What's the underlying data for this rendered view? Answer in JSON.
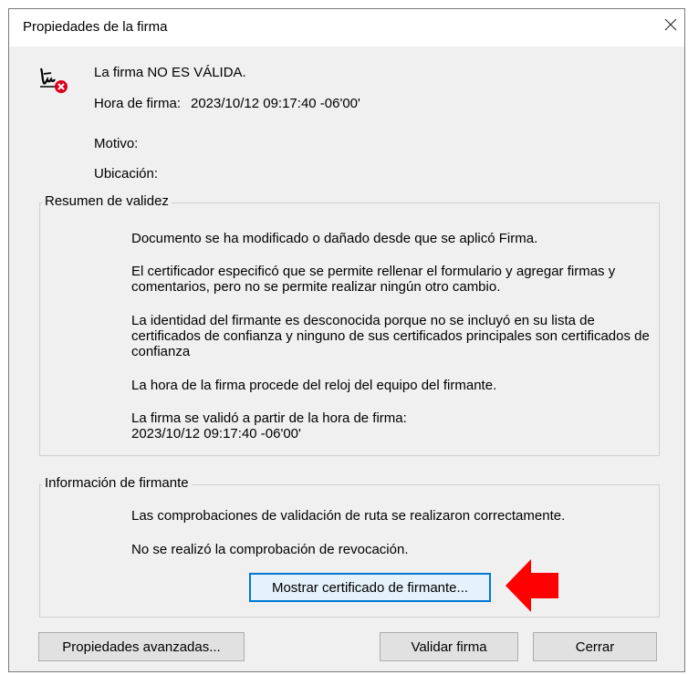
{
  "dialog": {
    "title": "Propiedades de la firma"
  },
  "signature": {
    "status": "La firma NO ES VÁLIDA.",
    "time_label": "Hora de firma:",
    "time_value": "2023/10/12 09:17:40 -06'00'",
    "reason_label": "Motivo:",
    "location_label": "Ubicación:"
  },
  "validity": {
    "label": "Resumen de validez",
    "items": [
      "Documento se ha modificado o dañado desde que se aplicó Firma.",
      "El certificador especificó que se permite rellenar el formulario y agregar firmas y comentarios, pero no se permite realizar ningún otro cambio.",
      "La identidad del firmante es desconocida porque no se incluyó en su lista de certificados de confianza y ninguno de sus certificados principales son certificados de confianza",
      "La hora de la firma procede del reloj del equipo del firmante.",
      "La firma se validó a partir de la hora de firma:\n2023/10/12 09:17:40 -06'00'"
    ]
  },
  "signer": {
    "label": "Información de firmante",
    "items": [
      "Las comprobaciones de validación de ruta se realizaron correctamente.",
      "No se realizó la comprobación de revocación."
    ],
    "show_cert_button": "Mostrar certificado de firmante..."
  },
  "buttons": {
    "advanced": "Propiedades avanzadas...",
    "validate": "Validar firma",
    "close": "Cerrar"
  },
  "colors": {
    "dialog_bg": "#f0f0f0",
    "error_red": "#d9001b",
    "focus_blue": "#0078d7",
    "annotation_arrow": "#ff0000"
  },
  "icons": {
    "signature": "signature-invalid-icon",
    "close": "close-icon",
    "arrow": "red-arrow-left-icon"
  }
}
